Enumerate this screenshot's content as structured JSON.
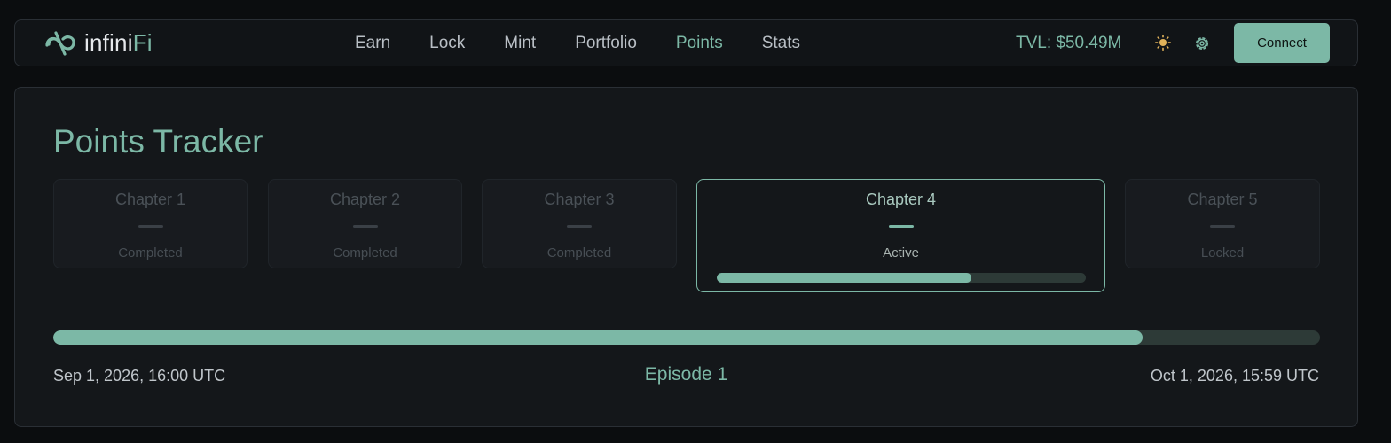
{
  "app": {
    "logo_text_a": "infini",
    "logo_text_b": "Fi"
  },
  "nav": {
    "links": [
      {
        "label": "Earn",
        "active": false
      },
      {
        "label": "Lock",
        "active": false
      },
      {
        "label": "Mint",
        "active": false
      },
      {
        "label": "Portfolio",
        "active": false
      },
      {
        "label": "Points",
        "active": true
      },
      {
        "label": "Stats",
        "active": false
      }
    ],
    "tvl": "TVL: $50.49M",
    "theme_icon": "sun-icon",
    "settings_icon": "gear-icon",
    "connect_label": "Connect"
  },
  "tracker": {
    "title": "Points Tracker",
    "chapters": [
      {
        "title": "Chapter 1",
        "status": "Completed"
      },
      {
        "title": "Chapter 2",
        "status": "Completed"
      },
      {
        "title": "Chapter 3",
        "status": "Completed"
      },
      {
        "title": "Chapter 4",
        "status": "Active",
        "progress_percent": 69
      },
      {
        "title": "Chapter 5",
        "status": "Locked"
      }
    ],
    "episode_progress_percent": 86,
    "start_date": "Sep 1, 2026, 16:00 UTC",
    "episode_label": "Episode 1",
    "end_date": "Oct 1, 2026, 15:59 UTC"
  },
  "colors": {
    "accent": "#7cb8a6",
    "background": "#0b0d0f",
    "panel": "#14171a"
  }
}
